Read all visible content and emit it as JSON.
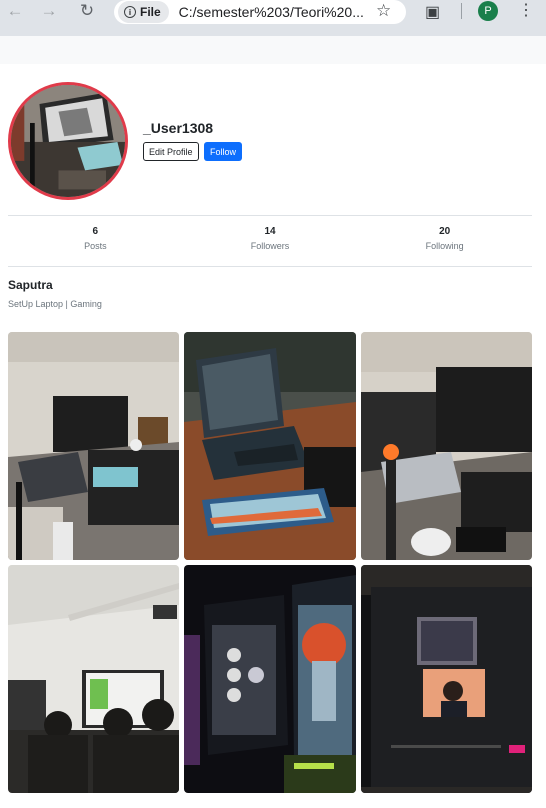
{
  "browser": {
    "scheme_label": "File",
    "info_glyph": "i",
    "url": "C:/semester%203/Teori%20...",
    "profile_initial": "P"
  },
  "profile": {
    "username": "_User1308",
    "edit_label": "Edit Profile",
    "follow_label": "Follow",
    "stats": [
      {
        "value": "6",
        "label": "Posts"
      },
      {
        "value": "14",
        "label": "Followers"
      },
      {
        "value": "20",
        "label": "Following"
      }
    ],
    "display_name": "Saputra",
    "bio": "SetUp Laptop | Gaming"
  },
  "colors": {
    "avatar_ring": "#e03b4a",
    "follow_button": "#0d6efd"
  },
  "posts": [
    {
      "icon": "laptop-desk-photo"
    },
    {
      "icon": "laptop-keyboard-photo"
    },
    {
      "icon": "desk-setup-photo"
    },
    {
      "icon": "classroom-photo"
    },
    {
      "icon": "gaming-pc-photo"
    },
    {
      "icon": "monitor-screen-photo"
    }
  ]
}
